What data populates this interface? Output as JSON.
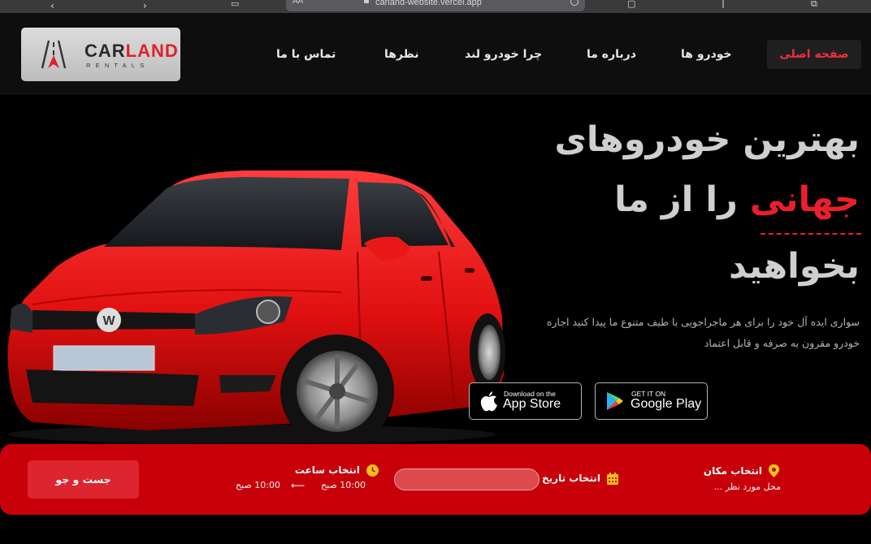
{
  "browser": {
    "url": "carland-website.vercel.app",
    "reader_label": "AA"
  },
  "logo": {
    "brand_dark": "CAR",
    "brand_red": "LAND",
    "subtitle": "RENTALS"
  },
  "nav": {
    "items": [
      {
        "label": "صفحه اصلی",
        "active": true
      },
      {
        "label": "خودرو ها"
      },
      {
        "label": "درباره ما"
      },
      {
        "label": "چرا خودرو لند"
      },
      {
        "label": "نظرها"
      },
      {
        "label": "تماس با ما"
      }
    ]
  },
  "hero": {
    "line1": "بهترین خودروهای",
    "line2_red": "جهانی",
    "line2_rest": "را از ما",
    "line3": "بخواهید",
    "desc_line1": "سواری ایده آل خود را برای هر ماجراجویی با طیف متنوع ما پیدا کنید اجاره",
    "desc_line2": "خودرو مقرون به صرفه و قابل اعتماد"
  },
  "stores": {
    "apple_small": "Download on the",
    "apple_big": "App Store",
    "google_small": "GET IT ON",
    "google_big": "Google Play"
  },
  "search": {
    "location_label": "انتخاب مکان",
    "location_placeholder": "محل مورد نظر ...",
    "date_label": "انتخاب تاریخ",
    "time_label": "انتخاب ساعت",
    "time_from": "10:00 صبح",
    "time_to": "10:00 صبح",
    "button_label": "جست و جو"
  },
  "colors": {
    "accent": "#e8202a",
    "search_bar": "#c8000a",
    "icon_yellow": "#f6c21a"
  },
  "icons": [
    "back-icon",
    "forward-icon",
    "bookmarks-icon",
    "share-icon",
    "tabs-icon",
    "location-pin-icon",
    "calendar-icon",
    "clock-icon",
    "arrow-left-icon",
    "apple-icon",
    "google-play-icon"
  ]
}
